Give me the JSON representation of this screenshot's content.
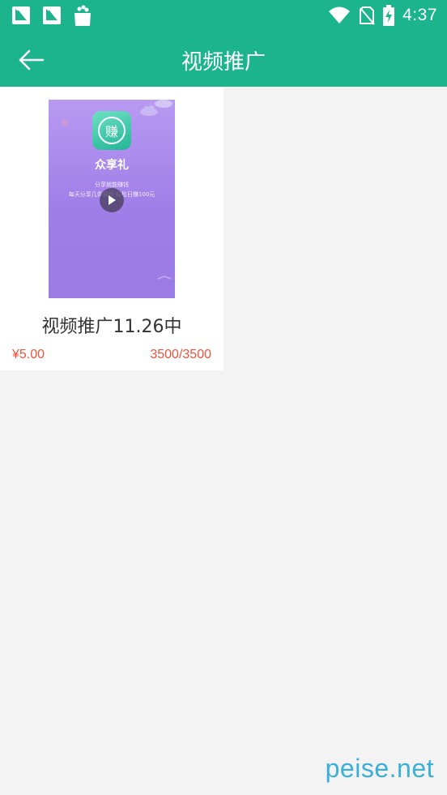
{
  "status_bar": {
    "time": "4:37",
    "left_icons": [
      "sail-app-icon",
      "sail-app-icon",
      "shopping-bag-icon"
    ],
    "right_icons": [
      "wifi-icon",
      "no-sim-icon",
      "battery-charging-icon"
    ]
  },
  "toolbar": {
    "title": "视频推广",
    "back_icon": "arrow-left-icon"
  },
  "items": [
    {
      "title": "视频推广11.26中",
      "price": "¥5.00",
      "count": "3500/3500",
      "thumbnail": {
        "logo_text": "赚",
        "app_name": "众享礼",
        "line1": "分享就能赚钱",
        "line2": "每天分享几条视频 轻松日赚100元",
        "play_icon": "play-icon"
      }
    }
  ],
  "watermark": "peise.net",
  "colors": {
    "primary": "#1bb48c",
    "price": "#f0513c",
    "background": "#f3f3f3",
    "thumbnail_purple": "#a482ea",
    "watermark": "#3ab0d8"
  }
}
